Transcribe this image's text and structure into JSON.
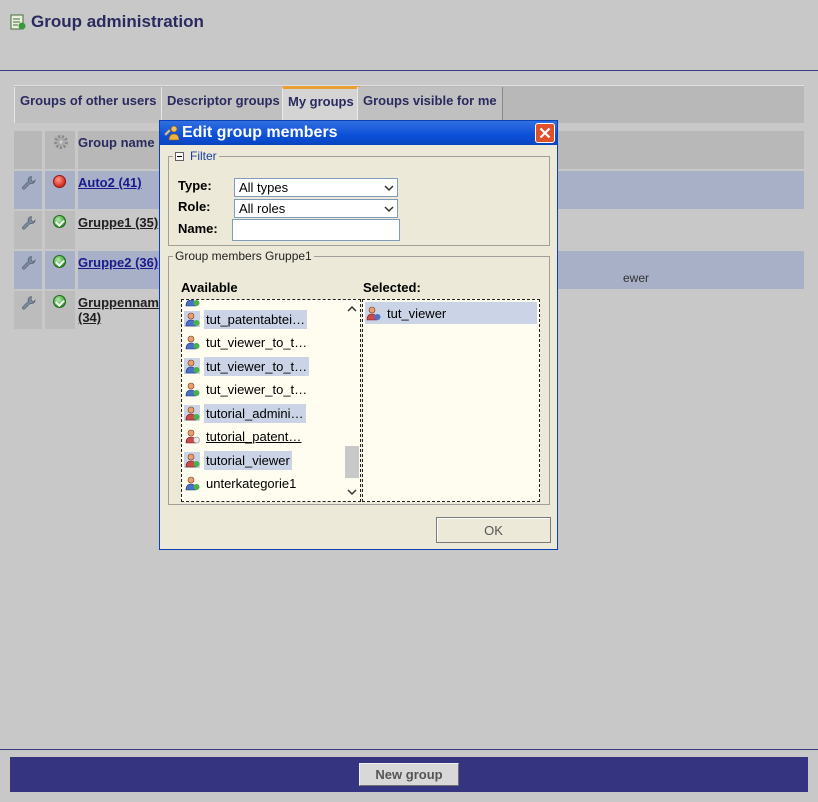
{
  "page": {
    "title": "Group administration"
  },
  "tabs": [
    {
      "label": "Groups of other users"
    },
    {
      "label": "Descriptor groups"
    },
    {
      "label": "My groups"
    },
    {
      "label": "Groups visible for me"
    }
  ],
  "table": {
    "header": {
      "name": "Group name"
    },
    "rows": [
      {
        "name": "Auto2 (41)",
        "status": "red"
      },
      {
        "name": "Gruppe1 (35)",
        "status": "green"
      },
      {
        "name": "Gruppe2 (36)",
        "status": "green",
        "note": "ewer"
      },
      {
        "name": "Gruppennam",
        "name_line2": "(34)",
        "status": "green"
      }
    ]
  },
  "footer": {
    "new_group_label": "New group"
  },
  "dialog": {
    "title": "Edit group members",
    "filter": {
      "legend": "Filter",
      "type_label": "Type:",
      "type_value": "All types",
      "role_label": "Role:",
      "role_value": "All roles",
      "name_label": "Name:",
      "name_value": ""
    },
    "members": {
      "legend": "Group members Gruppe1",
      "available_label": "Available",
      "selected_label": "Selected:",
      "available": [
        "tut_patentabtei…",
        "tut_viewer_to_t…",
        "tut_viewer_to_t…",
        "tut_viewer_to_t…",
        "tutorial_admini…",
        "tutorial_patent…",
        "tutorial_viewer",
        "unterkategorie1"
      ],
      "selected": [
        "tut_viewer"
      ]
    },
    "ok_label": "OK"
  }
}
